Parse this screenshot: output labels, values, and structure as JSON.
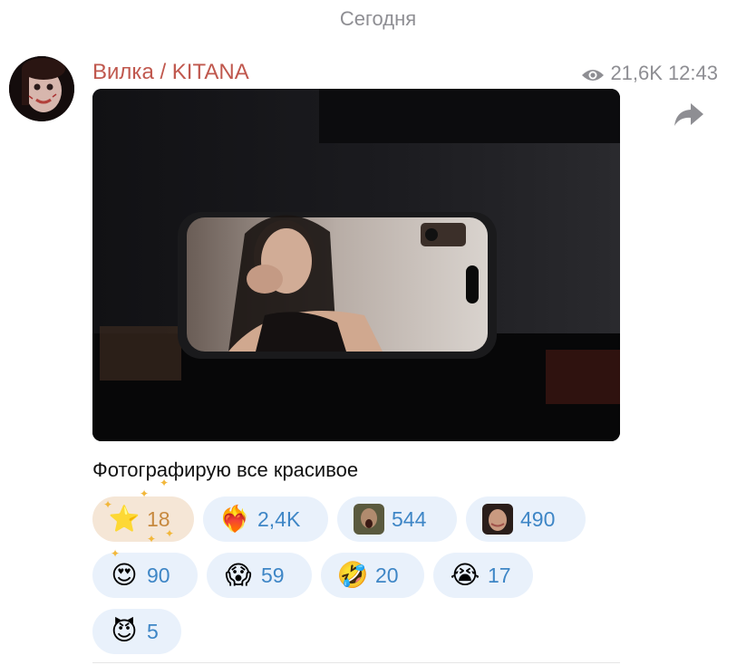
{
  "date_separator": "Сегодня",
  "post": {
    "author": "Вилка / KITANA",
    "views": "21,6K",
    "time": "12:43",
    "caption": "Фотографирую все красивое"
  },
  "reactions": [
    {
      "emoji": "⭐",
      "icon": "star-icon",
      "count": "18",
      "chosen": true
    },
    {
      "emoji": "❤️‍🔥",
      "icon": "heart-on-fire-icon",
      "count": "2,4K",
      "chosen": false
    },
    {
      "emoji": "",
      "icon": "custom-face-sticker-1-icon",
      "count": "544",
      "chosen": false
    },
    {
      "emoji": "",
      "icon": "custom-face-sticker-2-icon",
      "count": "490",
      "chosen": false
    },
    {
      "emoji": "😍",
      "icon": "heart-eyes-icon",
      "count": "90",
      "chosen": false
    },
    {
      "emoji": "😱",
      "icon": "scream-icon",
      "count": "59",
      "chosen": false
    },
    {
      "emoji": "🤣",
      "icon": "rofl-icon",
      "count": "20",
      "chosen": false
    },
    {
      "emoji": "😭",
      "icon": "crying-icon",
      "count": "17",
      "chosen": false
    },
    {
      "emoji": "😈",
      "icon": "devil-icon",
      "count": "5",
      "chosen": false
    }
  ],
  "colors": {
    "author": "#c0584e",
    "count": "#3e86c6",
    "chosen_bg": "#f5e6d6",
    "pill_bg": "#e9f1fb"
  }
}
